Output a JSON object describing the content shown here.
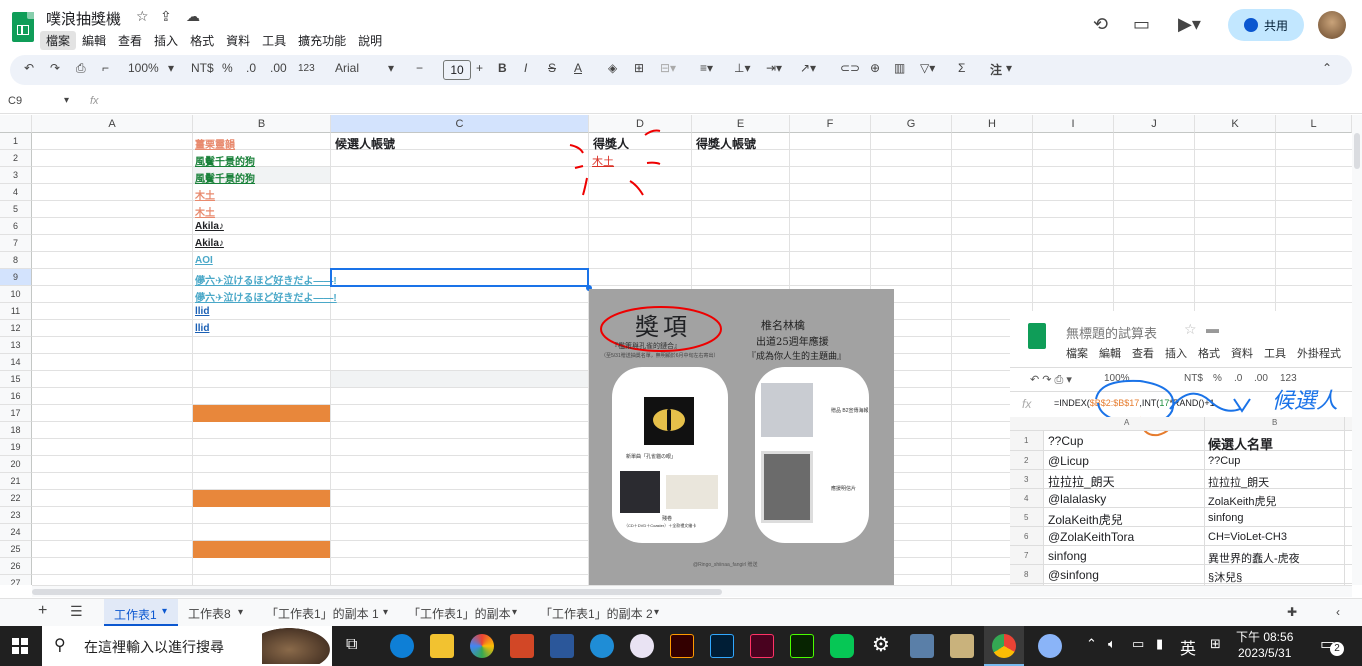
{
  "app": {
    "title": "噗浪抽獎機",
    "menus": [
      "檔案",
      "編輯",
      "查看",
      "插入",
      "格式",
      "資料",
      "工具",
      "擴充功能",
      "說明"
    ],
    "share_label": "共用"
  },
  "toolbar": {
    "zoom": "100%",
    "currency": "NT$",
    "percent": "%",
    "dec_less": ".0",
    "dec_more": ".00",
    "number_format": "123",
    "font": "Arial",
    "font_size": "10",
    "bold": "B",
    "italic": "I",
    "strike": "S",
    "text_color": "A",
    "sigma": "Σ",
    "note": "注"
  },
  "formula": {
    "name_box": "C9",
    "fx": "fx"
  },
  "columns": [
    "A",
    "B",
    "C",
    "D",
    "E",
    "F",
    "G",
    "H",
    "I",
    "J",
    "K",
    "L"
  ],
  "rows": [
    "1",
    "2",
    "3",
    "4",
    "5",
    "6",
    "7",
    "8",
    "9",
    "10",
    "11",
    "12",
    "13",
    "14",
    "15",
    "16",
    "17",
    "18",
    "19",
    "20",
    "21",
    "22",
    "23",
    "24",
    "25",
    "26",
    "27"
  ],
  "cells": {
    "B": [
      "薑栗靈韻",
      "風鬢千景的狗",
      "風鬢千景的狗",
      "木土",
      "木土",
      "Akila♪",
      "Akila♪",
      "AOI",
      "儚六✈泣けるほど好きだよ——!",
      "儚六✈泣けるほど好きだよ——!",
      "llid",
      "llid"
    ],
    "C1": "候選人帳號",
    "D1": "得獎人",
    "D2": "木土",
    "E1": "得獎人帳號"
  },
  "poster": {
    "left_title": "獎項",
    "left_sub": "『檻策與孔雀的鏈合』",
    "left_small": "（至5/31贈送抽獎名單，無明顯於6月中旬左右寄出）",
    "left_card_caption": "新單曲「孔雀貓の眼」",
    "left_card_caption2": "殘卷",
    "left_card_foot": "（CD＋DVD＋Coaster）＋全款禮文繪卡",
    "right_title1": "椎名林檎",
    "right_title2": "出道25週年應援",
    "right_title3": "『成為你人生的主題曲』",
    "right_card_label1": "贈品 B2宣傳海報",
    "right_card_label2": "應援明信片",
    "footer": "@Ringo_shiinaa_fangirl 贈送"
  },
  "inset": {
    "title": "無標題的試算表",
    "menus": [
      "檔案",
      "編輯",
      "查看",
      "插入",
      "格式",
      "資料",
      "工具",
      "外掛程式"
    ],
    "zoom": "100%",
    "currency": "NT$",
    "percent": "%",
    "dec_less": ".0",
    "dec_more": ".00",
    "number_format": "123",
    "fx": "fx",
    "formula_a": "=INDEX(",
    "formula_b": "$B$2:$B$17",
    "formula_c": ",INT(",
    "formula_d": "17",
    "formula_e": "*RAND()+1",
    "annotation": "候選人",
    "col_a": "A",
    "col_b": "B",
    "rows": [
      {
        "n": "1",
        "a": "??Cup",
        "b": "候選人名單"
      },
      {
        "n": "2",
        "a": "@Licup",
        "b": "??Cup"
      },
      {
        "n": "3",
        "a": "拉拉拉_朗天",
        "b": "拉拉拉_朗天"
      },
      {
        "n": "4",
        "a": "@lalalasky",
        "b": "ZolaKeith虎兒"
      },
      {
        "n": "5",
        "a": "ZolaKeith虎兒",
        "b": "sinfong"
      },
      {
        "n": "6",
        "a": "@ZolaKeithTora",
        "b": "CH=VioLet-CH3"
      },
      {
        "n": "7",
        "a": "sinfong",
        "b": "異世界的蠢人-虎夜"
      },
      {
        "n": "8",
        "a": "@sinfong",
        "b": "§沐兒§"
      }
    ]
  },
  "sheet_tabs": [
    "工作表1",
    "工作表8",
    "「工作表1」的副本 1",
    "「工作表1」的副本",
    "「工作表1」的副本 2"
  ],
  "taskbar": {
    "search_placeholder": "在這裡輸入以進行搜尋",
    "ime": "英",
    "time": "下午 08:56",
    "date": "2023/5/31",
    "notif_count": "2"
  },
  "colors": {
    "sheets_green": "#0f9d58",
    "share_bg": "#c2e7ff",
    "selection": "#1a73e8",
    "orange_fill": "#e8873b",
    "link_salmon": "#e88a6e",
    "link_green": "#188038",
    "link_teal": "#4aa8c8",
    "link_blue": "#1a5fb4"
  }
}
